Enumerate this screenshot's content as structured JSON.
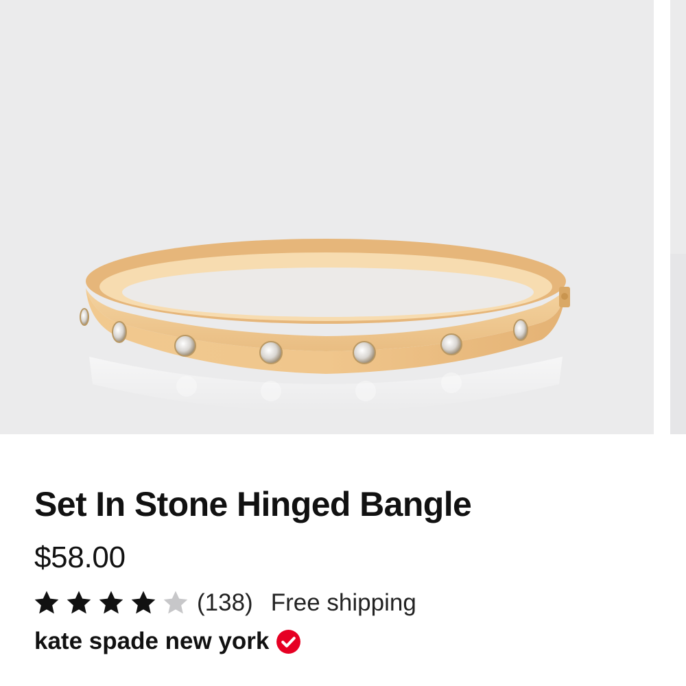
{
  "product": {
    "title": "Set In Stone Hinged Bangle",
    "price": "$58.00",
    "rating": {
      "value": 4,
      "max": 5,
      "review_count": "(138)"
    },
    "shipping": "Free shipping",
    "seller": "kate spade new york",
    "seller_verified": true,
    "image_alt": "gold hinged bangle with crystal stones"
  },
  "colors": {
    "star_filled": "#111111",
    "star_empty": "#c7c7c9",
    "verified_badge": "#e60023",
    "image_background": "#ebebec"
  },
  "icons": {
    "star": "star-icon",
    "verified": "verified-check-icon"
  }
}
